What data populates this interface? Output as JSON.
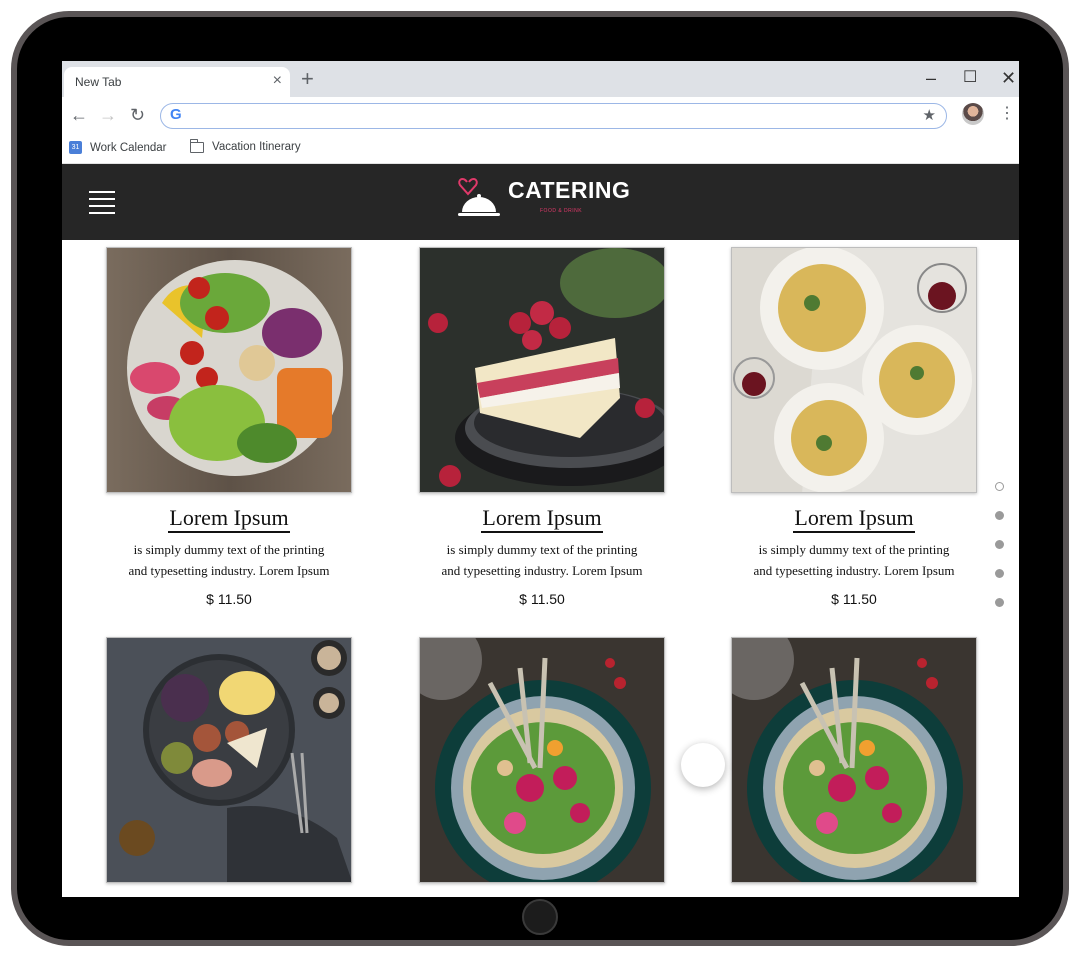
{
  "browser": {
    "tab_title": "New Tab",
    "tab_close": "×",
    "new_tab": "+",
    "minimize": "–",
    "maximize": "☐",
    "close": "✕",
    "back": "←",
    "forward": "→",
    "reload": "↻",
    "omnibox_value": "",
    "google_logo": "G",
    "bookmark_star": "★",
    "menu": "⋮",
    "bookmarks": [
      {
        "label": "Work Calendar",
        "icon": "calendar-icon"
      },
      {
        "label": "Vacation Itinerary",
        "icon": "folder-icon"
      }
    ],
    "calendar_day": "31"
  },
  "site": {
    "brand": "CATERING",
    "tagline": "FOOD & DRINK",
    "brand_color": "#e0396a",
    "header_bg": "#262626"
  },
  "products": [
    {
      "title": "Lorem Ipsum",
      "desc1": "is simply dummy text of the printing",
      "desc2": "and typesetting industry. Lorem Ipsum",
      "price": "$ 11.50",
      "image": "salad-bowl"
    },
    {
      "title": "Lorem Ipsum",
      "desc1": "is simply dummy text of the printing",
      "desc2": "and typesetting industry. Lorem Ipsum",
      "price": "$ 11.50",
      "image": "raspberry-cake"
    },
    {
      "title": "Lorem Ipsum",
      "desc1": "is simply dummy text of the printing",
      "desc2": "and typesetting industry. Lorem Ipsum",
      "price": "$ 11.50",
      "image": "pasta-plates"
    },
    {
      "image": "cheese-fruit-platter"
    },
    {
      "image": "hummus-bowl"
    },
    {
      "image": "hummus-bowl"
    }
  ],
  "pagination": {
    "total": 5,
    "active": 0
  }
}
